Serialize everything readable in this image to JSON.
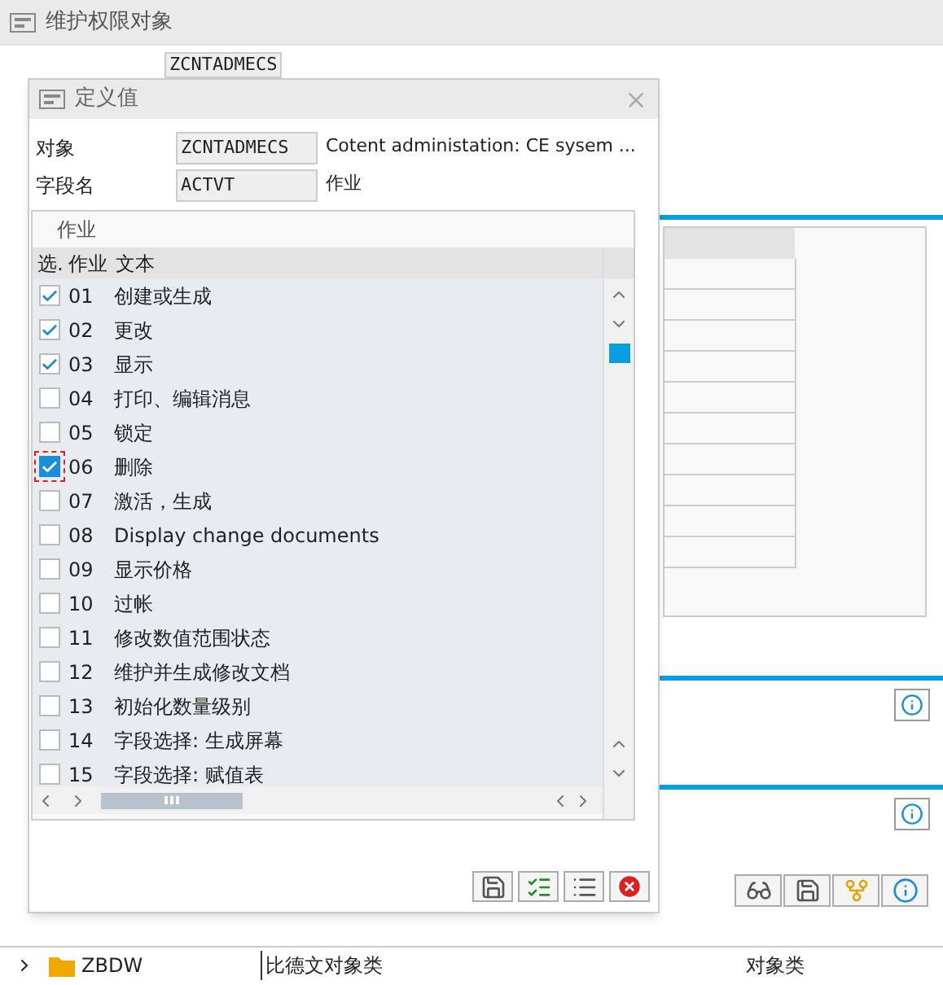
{
  "window": {
    "title": "维护权限对象"
  },
  "background": {
    "object_field": "ZCNTADMECS",
    "toolbar": [
      {
        "kind": "glasses"
      },
      {
        "kind": "save"
      },
      {
        "kind": "hierarchy"
      },
      {
        "kind": "info"
      }
    ]
  },
  "tree": [
    {
      "name": "ZBDW",
      "description": "比德文对象类",
      "type": "对象类",
      "expanded": false
    }
  ],
  "dialog": {
    "title": "定义值",
    "fields": [
      {
        "label": "对象",
        "value": "ZCNTADMECS",
        "description": "Cotent administation: CE sysem ..."
      },
      {
        "label": "字段名",
        "value": "ACTVT",
        "description": "作业"
      }
    ],
    "table": {
      "title": "作业",
      "columns": [
        "选.",
        "作业",
        "文本"
      ],
      "rows": [
        {
          "code": "01",
          "text": "创建或生成",
          "checked": true,
          "focused": false
        },
        {
          "code": "02",
          "text": "更改",
          "checked": true,
          "focused": false
        },
        {
          "code": "03",
          "text": "显示",
          "checked": true,
          "focused": false
        },
        {
          "code": "04",
          "text": "打印、编辑消息",
          "checked": false,
          "focused": false
        },
        {
          "code": "05",
          "text": "锁定",
          "checked": false,
          "focused": false
        },
        {
          "code": "06",
          "text": "删除",
          "checked": true,
          "focused": true
        },
        {
          "code": "07",
          "text": "激活，生成",
          "checked": false,
          "focused": false
        },
        {
          "code": "08",
          "text": "Display change documents",
          "checked": false,
          "focused": false
        },
        {
          "code": "09",
          "text": "显示价格",
          "checked": false,
          "focused": false
        },
        {
          "code": "10",
          "text": "过帐",
          "checked": false,
          "focused": false
        },
        {
          "code": "11",
          "text": "修改数值范围状态",
          "checked": false,
          "focused": false
        },
        {
          "code": "12",
          "text": "维护并生成修改文档",
          "checked": false,
          "focused": false
        },
        {
          "code": "13",
          "text": "初始化数量级别",
          "checked": false,
          "focused": false
        },
        {
          "code": "14",
          "text": "字段选择: 生成屏幕",
          "checked": false,
          "focused": false
        },
        {
          "code": "15",
          "text": "字段选择: 赋值表",
          "checked": false,
          "focused": false
        }
      ]
    },
    "buttons": [
      {
        "kind": "save"
      },
      {
        "kind": "select-all"
      },
      {
        "kind": "deselect-all"
      },
      {
        "kind": "cancel"
      }
    ]
  }
}
